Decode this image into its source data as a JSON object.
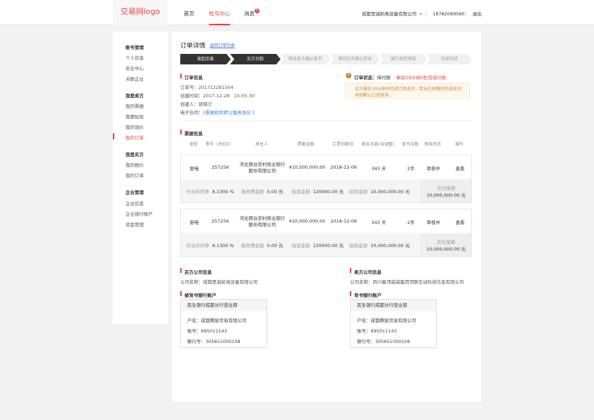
{
  "header": {
    "logo": "交易网logo",
    "nav": [
      {
        "label": "首页"
      },
      {
        "label": "账号中心"
      },
      {
        "label": "消息",
        "badge": "5"
      }
    ],
    "company": "成都思诚机电设备有限公司",
    "phone": "18782089580",
    "logout": "退出"
  },
  "sidebar": {
    "groups": [
      {
        "title": "账号管理",
        "items": [
          "个人信息",
          "安全中心",
          "关联企业"
        ]
      },
      {
        "title": "我是卖方",
        "items": [
          "我的票据",
          "我要贴现",
          "我的询价",
          "我的订单"
        ]
      },
      {
        "title": "我是买方",
        "items": [
          "我的报价",
          "我的订单"
        ]
      },
      {
        "title": "企业管理",
        "items": [
          "企业信息",
          "企业银行账户",
          "资金管理"
        ]
      }
    ],
    "active": "我的订单"
  },
  "order": {
    "title": "订单详情",
    "back_link": "返回订单列表",
    "steps": [
      "发起交易",
      "买方付款",
      "等待卖方确认背书",
      "等待买方确认签收",
      "银行风控审核",
      "交易完成"
    ],
    "steps_done": 2,
    "info_title": "订单信息",
    "order_no": "订单号：201712281504",
    "created_time": "创建时间：2017-12-28　15:05:30",
    "creator": "创建人：郭晓兰",
    "contract_label": "电子合同：",
    "contract_link": "《票据权利转让服务协议 》",
    "status_label": "订单状态：",
    "status_value": "待付款",
    "countdown": "剩余29分钟0秒完成付款",
    "notice_line1": "买方需在30分钟内完成订单支付，若未在时限内完成支付，",
    "notice_line2": "系统默认订单取消。"
  },
  "bills": {
    "title": "票据信息",
    "headers": [
      "类型",
      "票号（后6位）",
      "承兑人",
      "票面金额",
      "汇票到期日",
      "剩余天数(含调整)",
      "背书次数",
      "审核状态",
      "操作"
    ],
    "rows": [
      {
        "type": "银电",
        "bill_no": "257256",
        "acceptor_1": "河北邢台农村商业银行",
        "acceptor_2": "股份有限公司",
        "amount": "¥10,000,000.00",
        "due_date": "2018-12-06",
        "days": "343 天",
        "endorse": "2手",
        "audit": "审核中",
        "action": "查看",
        "rate_label": "约合年利率",
        "rate": "6.1300 %",
        "fee_label": "服务费金额",
        "fee": "0.00 元",
        "interest_label": "贴息金额",
        "interest": "120000.00 元",
        "discount_label": "贴现金额",
        "discount": "10,000,000.00 元",
        "payable_label": "应付金额",
        "payable": "10,000,000.00 元"
      },
      {
        "type": "银电",
        "bill_no": "257256",
        "acceptor_1": "河北邢台农村商业银行",
        "acceptor_2": "股份有限公司",
        "amount": "¥10,000,000.00",
        "due_date": "2018-12-06",
        "days": "343 天",
        "endorse": "2手",
        "audit": "审核中",
        "action": "查看",
        "rate_label": "约合年利率",
        "rate": "6.1300 %",
        "fee_label": "服务费金额",
        "fee": "0.00 元",
        "interest_label": "贴息金额",
        "interest": "120000.00 元",
        "discount_label": "贴现金额",
        "discount": "10,000,000.00 元",
        "payable_label": "应付金额",
        "payable": "10,000,000.00 元"
      }
    ]
  },
  "buyer": {
    "title": "买方公司信息",
    "company": "公司名称：成都思诚机电设备有限公司",
    "account_title": "被背书银行账户",
    "bank": "民生银行成都分行营业部",
    "holder": "户名：成都腾宸贸易有限公司",
    "account": "账号：695011143",
    "bank_no": "联行号：305651000108"
  },
  "seller": {
    "title": "卖方公司信息",
    "company": "公司名称：四川秦顶威威集团顶联互动科技信息有限公司",
    "account_title": "背书银行账户",
    "bank": "民生银行成都分行营业部",
    "holder": "户名：成都腾宸贸易有限公司",
    "account": "账号：695011143",
    "bank_no": "联行号：305651000108"
  },
  "colors": {
    "accent": "#e04545",
    "link": "#3a7bd5",
    "step_done": "#333333",
    "notice": "#c9853a"
  }
}
